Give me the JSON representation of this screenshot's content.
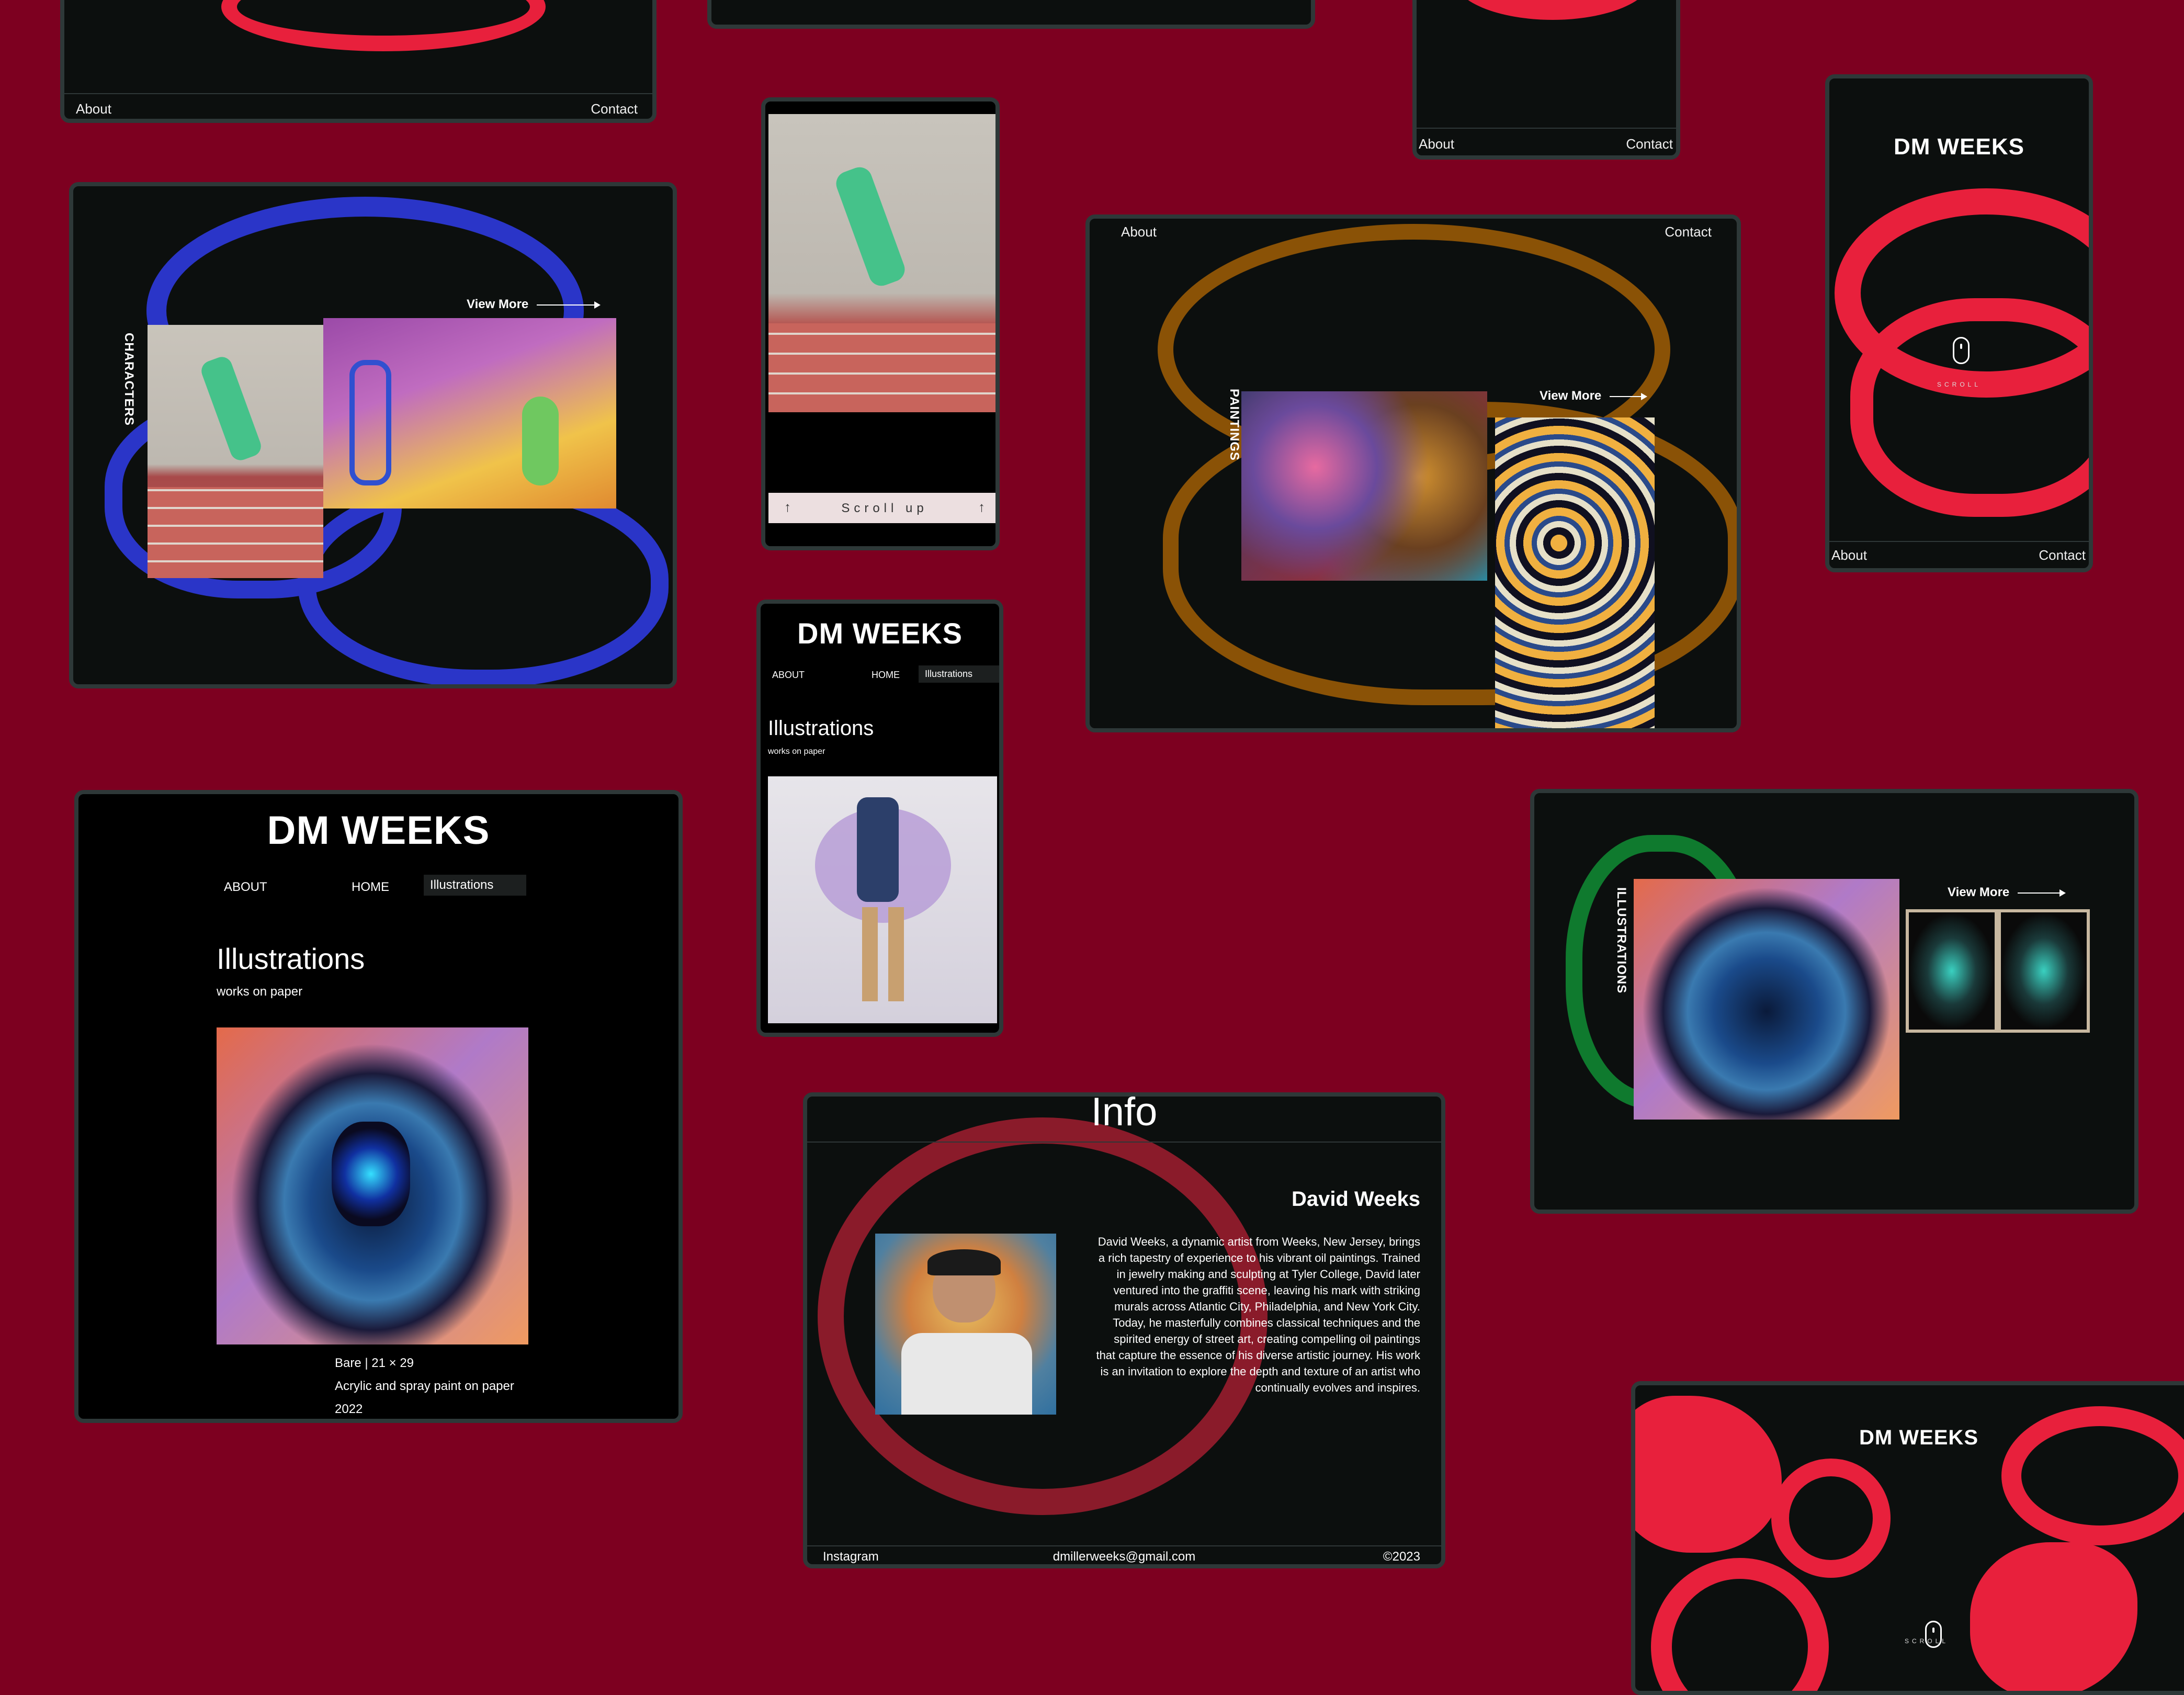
{
  "brand": "DM WEEKS",
  "nav": {
    "about": "About",
    "contact": "Contact"
  },
  "menu": {
    "about": "ABOUT",
    "home": "HOME",
    "illustrations": "Illustrations"
  },
  "sections": {
    "characters": "CHARACTERS",
    "paintings": "PAINTINGS",
    "illustrations": "ILLUSTRATIONS"
  },
  "view_more": "View More",
  "scroll": "SCROLL",
  "scroll_up": "Scroll up",
  "illustrations_page": {
    "title": "Illustrations",
    "subtitle": "works on paper",
    "artwork": {
      "name": "Bare",
      "size": "21 × 29",
      "medium": "Acrylic and spray paint on paper",
      "year": "2022"
    }
  },
  "info_page": {
    "title": "Info",
    "name": "David Weeks",
    "bio": "David Weeks, a dynamic artist from Weeks, New Jersey, brings a rich tapestry of experience to his vibrant oil paintings. Trained in jewelry making and sculpting at Tyler College, David later ventured into the graffiti scene, leaving his mark with striking murals across Atlantic City, Philadelphia, and New York City. Today, he masterfully combines classical techniques and the spirited energy of street art, creating compelling oil paintings that capture the essence of his diverse artistic journey. His work is an invitation to explore the depth and texture of an artist who continually evolves and inspires.",
    "footer": {
      "instagram": "Instagram",
      "email": "dmillerweeks@gmail.com",
      "copyright": "©2023"
    }
  },
  "colors": {
    "background": "#7d0020",
    "frame": "#0c0f0e",
    "red_brush": "#e8203c",
    "blue_brush": "#2a35c8",
    "orange_brush": "#8a5206",
    "green_brush": "#0f7a2e"
  }
}
